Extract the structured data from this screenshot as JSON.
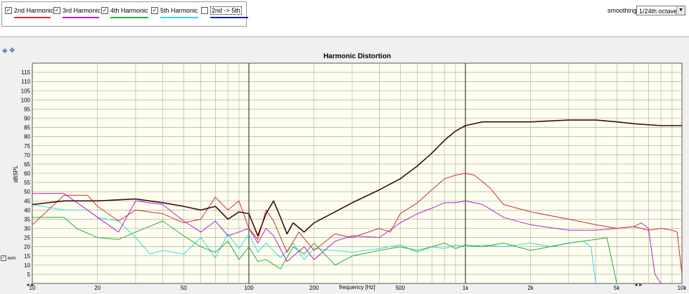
{
  "legend": [
    {
      "label": "2nd Harmonic",
      "checked": true,
      "color": "#d42a2a"
    },
    {
      "label": "3rd Harmonic",
      "checked": true,
      "color": "#b020c0"
    },
    {
      "label": "4th Harmonic",
      "checked": true,
      "color": "#20b030"
    },
    {
      "label": "5th Harmonic",
      "checked": true,
      "color": "#30d8e8"
    },
    {
      "label": "2nd -> 5th",
      "checked": false,
      "color": "#1020a0"
    }
  ],
  "smoothing": {
    "label": "smoothing",
    "value": "1/24th octave"
  },
  "auto_label": "auto",
  "chart_data": {
    "type": "line",
    "title": "Harmonic Distortion",
    "xlabel": "frequency [Hz]",
    "ylabel": "dBSPL",
    "xscale": "log",
    "xlim": [
      10,
      10000
    ],
    "ylim": [
      0,
      120
    ],
    "grid": true,
    "x_ticks": [
      {
        "v": 10,
        "t": "10"
      },
      {
        "v": 20,
        "t": "20"
      },
      {
        "v": 50,
        "t": "50"
      },
      {
        "v": 100,
        "t": "100"
      },
      {
        "v": 200,
        "t": "200"
      },
      {
        "v": 500,
        "t": "500"
      },
      {
        "v": 1000,
        "t": "1k"
      },
      {
        "v": 2000,
        "t": "2k"
      },
      {
        "v": 5000,
        "t": "5k"
      },
      {
        "v": 10000,
        "t": "10k"
      }
    ],
    "y_ticks": [
      5,
      10,
      15,
      20,
      25,
      30,
      35,
      40,
      45,
      50,
      55,
      60,
      65,
      70,
      75,
      80,
      85,
      90,
      95,
      100,
      105,
      110,
      115
    ],
    "series": [
      {
        "color": "#3a0a0a",
        "width": 1.6,
        "points": [
          [
            10,
            43
          ],
          [
            14,
            45
          ],
          [
            20,
            45
          ],
          [
            30,
            46
          ],
          [
            40,
            44
          ],
          [
            50,
            42
          ],
          [
            60,
            40
          ],
          [
            70,
            42
          ],
          [
            80,
            35
          ],
          [
            90,
            39
          ],
          [
            100,
            38
          ],
          [
            110,
            26
          ],
          [
            120,
            38
          ],
          [
            130,
            45
          ],
          [
            140,
            36
          ],
          [
            150,
            27
          ],
          [
            160,
            33
          ],
          [
            180,
            28
          ],
          [
            200,
            33
          ],
          [
            250,
            39
          ],
          [
            300,
            44
          ],
          [
            400,
            51
          ],
          [
            500,
            57
          ],
          [
            600,
            64
          ],
          [
            700,
            71
          ],
          [
            800,
            78
          ],
          [
            900,
            83
          ],
          [
            1000,
            86
          ],
          [
            1200,
            88
          ],
          [
            2000,
            88
          ],
          [
            3000,
            89
          ],
          [
            4000,
            89
          ],
          [
            5000,
            88
          ],
          [
            6000,
            87
          ],
          [
            8000,
            86
          ],
          [
            10000,
            86
          ]
        ]
      },
      {
        "color": "#d42a2a",
        "width": 1,
        "points": [
          [
            10,
            32
          ],
          [
            14,
            48
          ],
          [
            18,
            48
          ],
          [
            20,
            42
          ],
          [
            25,
            34
          ],
          [
            30,
            40
          ],
          [
            40,
            38
          ],
          [
            50,
            33
          ],
          [
            60,
            35
          ],
          [
            70,
            47
          ],
          [
            80,
            40
          ],
          [
            90,
            45
          ],
          [
            100,
            30
          ],
          [
            110,
            24
          ],
          [
            120,
            40
          ],
          [
            130,
            34
          ],
          [
            150,
            17
          ],
          [
            170,
            28
          ],
          [
            200,
            18
          ],
          [
            250,
            27
          ],
          [
            300,
            25
          ],
          [
            400,
            30
          ],
          [
            450,
            28
          ],
          [
            500,
            38
          ],
          [
            600,
            44
          ],
          [
            700,
            51
          ],
          [
            800,
            57
          ],
          [
            900,
            59
          ],
          [
            1000,
            60
          ],
          [
            1100,
            59
          ],
          [
            1300,
            52
          ],
          [
            1500,
            43
          ],
          [
            2000,
            39
          ],
          [
            3000,
            35
          ],
          [
            4000,
            32
          ],
          [
            5000,
            30
          ],
          [
            6000,
            31
          ],
          [
            7000,
            29
          ],
          [
            8000,
            30
          ],
          [
            9000,
            29
          ],
          [
            9500,
            28
          ],
          [
            10000,
            5
          ]
        ]
      },
      {
        "color": "#b020c0",
        "width": 1,
        "points": [
          [
            10,
            49
          ],
          [
            14,
            49
          ],
          [
            18,
            40
          ],
          [
            20,
            36
          ],
          [
            25,
            28
          ],
          [
            30,
            45
          ],
          [
            40,
            43
          ],
          [
            50,
            34
          ],
          [
            60,
            28
          ],
          [
            70,
            34
          ],
          [
            80,
            26
          ],
          [
            90,
            28
          ],
          [
            100,
            30
          ],
          [
            110,
            22
          ],
          [
            120,
            30
          ],
          [
            130,
            26
          ],
          [
            150,
            12
          ],
          [
            180,
            20
          ],
          [
            200,
            13
          ],
          [
            250,
            23
          ],
          [
            300,
            26
          ],
          [
            400,
            25
          ],
          [
            500,
            33
          ],
          [
            600,
            38
          ],
          [
            700,
            41
          ],
          [
            800,
            44
          ],
          [
            900,
            44
          ],
          [
            1000,
            45
          ],
          [
            1200,
            43
          ],
          [
            1500,
            36
          ],
          [
            2000,
            32
          ],
          [
            3000,
            29
          ],
          [
            4000,
            29
          ],
          [
            5000,
            30
          ],
          [
            6000,
            31
          ],
          [
            6500,
            33
          ],
          [
            7000,
            30
          ],
          [
            7500,
            5
          ],
          [
            8000,
            0
          ]
        ]
      },
      {
        "color": "#20b030",
        "width": 1,
        "points": [
          [
            10,
            36
          ],
          [
            14,
            36
          ],
          [
            16,
            30
          ],
          [
            20,
            25
          ],
          [
            25,
            24
          ],
          [
            30,
            28
          ],
          [
            40,
            34
          ],
          [
            50,
            26
          ],
          [
            60,
            20
          ],
          [
            70,
            17
          ],
          [
            80,
            23
          ],
          [
            90,
            13
          ],
          [
            100,
            20
          ],
          [
            110,
            12
          ],
          [
            120,
            13
          ],
          [
            140,
            8
          ],
          [
            160,
            20
          ],
          [
            180,
            16
          ],
          [
            200,
            22
          ],
          [
            250,
            10
          ],
          [
            300,
            15
          ],
          [
            400,
            18
          ],
          [
            500,
            20
          ],
          [
            600,
            18
          ],
          [
            700,
            20
          ],
          [
            800,
            22
          ],
          [
            900,
            19
          ],
          [
            1000,
            21
          ],
          [
            1200,
            20
          ],
          [
            1500,
            22
          ],
          [
            2000,
            18
          ],
          [
            3000,
            22
          ],
          [
            4000,
            24
          ],
          [
            4500,
            25
          ],
          [
            5000,
            0
          ]
        ]
      },
      {
        "color": "#30d8e8",
        "width": 1,
        "points": [
          [
            10,
            43
          ],
          [
            14,
            40
          ],
          [
            18,
            40
          ],
          [
            20,
            36
          ],
          [
            25,
            34
          ],
          [
            30,
            25
          ],
          [
            35,
            16
          ],
          [
            40,
            18
          ],
          [
            50,
            16
          ],
          [
            60,
            25
          ],
          [
            70,
            14
          ],
          [
            80,
            27
          ],
          [
            90,
            19
          ],
          [
            100,
            27
          ],
          [
            110,
            17
          ],
          [
            120,
            22
          ],
          [
            140,
            14
          ],
          [
            160,
            22
          ],
          [
            180,
            13
          ],
          [
            200,
            19
          ],
          [
            300,
            17
          ],
          [
            400,
            19
          ],
          [
            500,
            21
          ],
          [
            600,
            17
          ],
          [
            700,
            20
          ],
          [
            800,
            19
          ],
          [
            900,
            21
          ],
          [
            1000,
            20
          ],
          [
            1200,
            21
          ],
          [
            1500,
            20
          ],
          [
            2000,
            22
          ],
          [
            2500,
            20
          ],
          [
            3000,
            22
          ],
          [
            3500,
            23
          ],
          [
            3800,
            20
          ],
          [
            4000,
            0
          ]
        ]
      }
    ]
  }
}
